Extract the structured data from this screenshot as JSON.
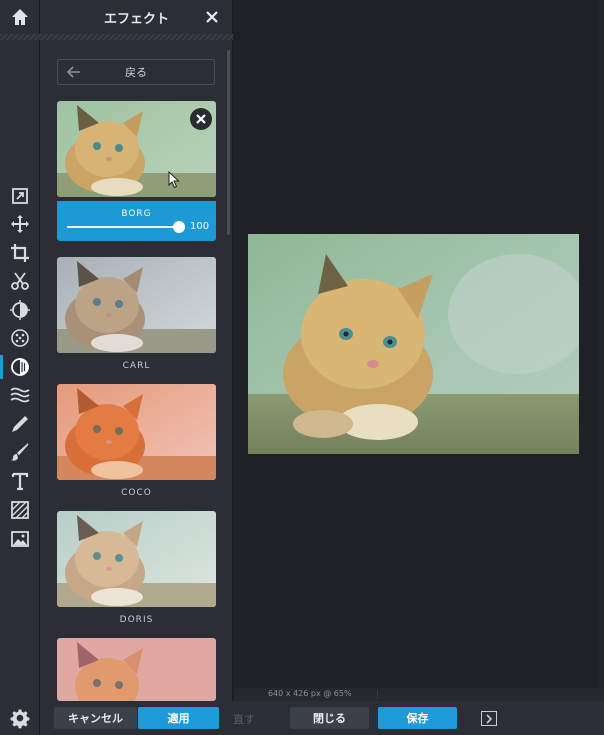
{
  "panel": {
    "title": "エフェクト",
    "back_label": "戻る",
    "cancel_label": "キャンセル",
    "apply_label": "適用"
  },
  "active_effect": {
    "name": "BORG",
    "value": "100",
    "level_percent": 100
  },
  "effects": [
    {
      "name": "CARL"
    },
    {
      "name": "COCO"
    },
    {
      "name": "DORIS"
    }
  ],
  "status": {
    "image_info": "640 x 426 px @ 65%"
  },
  "bottom": {
    "redo_label": "直す",
    "close_label": "閉じる",
    "save_label": "保存"
  },
  "icons": {
    "home": "home-icon",
    "settings": "gear-icon",
    "tools": [
      "resize-icon",
      "move-icon",
      "crop-icon",
      "cut-icon",
      "adjust-icon",
      "filter-dots-icon",
      "effect-icon",
      "wave-icon",
      "pipette-icon",
      "brush-icon",
      "text-icon",
      "texture-icon",
      "image-icon"
    ]
  },
  "colors": {
    "accent": "#1e9ad8",
    "panel_bg": "#2b2e34",
    "canvas_bg": "#1f2126"
  }
}
